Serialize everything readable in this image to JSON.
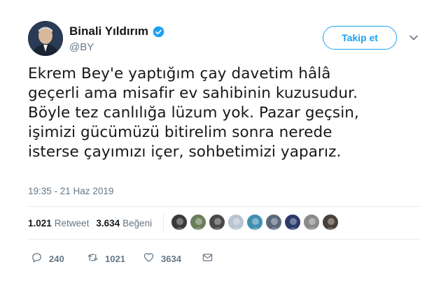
{
  "author": {
    "name": "Binali Yıldırım",
    "handle": "@BY",
    "verified": true
  },
  "follow_label": "Takip et",
  "tweet": {
    "text": "Ekrem Bey'e yaptığım çay davetim hâlâ\ngeçerli ama misafir ev sahibinin kuzusudur.\nBöyle tez canlılığa lüzum yok. Pazar geçsin,\nişimizi gücümüzü bitirelim sonra nerede\nisterse çayımızı içer, sohbetimizi yaparız.",
    "timestamp": "19:35 - 21 Haz 2019"
  },
  "stats": {
    "retweets_count": "1.021",
    "retweets_label": "Retweet",
    "likes_count": "3.634",
    "likes_label": "Beğeni"
  },
  "liker_avatar_colors": [
    "#3a3a3a",
    "#6b7f5a",
    "#4a4a4a",
    "#b8c4d0",
    "#3f8fb0",
    "#5a6a7a",
    "#2a3a6a",
    "#8a8a8a",
    "#4a4038"
  ],
  "actions": {
    "replies": "240",
    "retweets": "1021",
    "likes": "3634"
  },
  "colors": {
    "accent": "#1da1f2",
    "secondary_text": "#657786",
    "primary_text": "#14171a"
  }
}
